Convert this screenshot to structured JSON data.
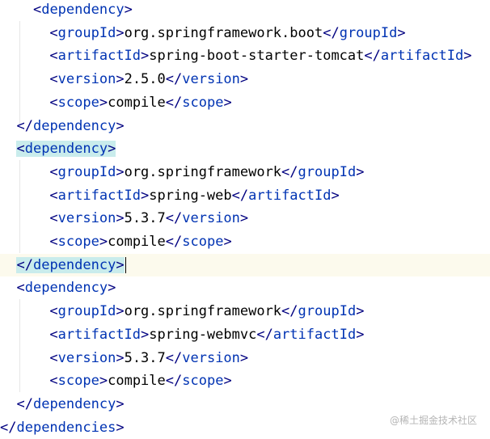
{
  "editor": {
    "lines": [
      {
        "open": "<",
        "name": "dependency",
        "close": ">"
      },
      {
        "open": "<",
        "name": "groupId",
        "close": ">",
        "value": "org.springframework.boot",
        "end_open": "</",
        "end_name": "groupId",
        "end_close": ">"
      },
      {
        "open": "<",
        "name": "artifactId",
        "close": ">",
        "value": "spring-boot-starter-tomcat",
        "end_open": "</",
        "end_name": "artifactId",
        "end_close": ">"
      },
      {
        "open": "<",
        "name": "version",
        "close": ">",
        "value": "2.5.0",
        "end_open": "</",
        "end_name": "version",
        "end_close": ">"
      },
      {
        "open": "<",
        "name": "scope",
        "close": ">",
        "value": "compile",
        "end_open": "</",
        "end_name": "scope",
        "end_close": ">"
      },
      {
        "open": "</",
        "name": "dependency",
        "close": ">"
      },
      {
        "open": "<",
        "name": "dependency",
        "close": ">"
      },
      {
        "open": "<",
        "name": "groupId",
        "close": ">",
        "value": "org.springframework",
        "end_open": "</",
        "end_name": "groupId",
        "end_close": ">"
      },
      {
        "open": "<",
        "name": "artifactId",
        "close": ">",
        "value": "spring-web",
        "end_open": "</",
        "end_name": "artifactId",
        "end_close": ">"
      },
      {
        "open": "<",
        "name": "version",
        "close": ">",
        "value": "5.3.7",
        "end_open": "</",
        "end_name": "version",
        "end_close": ">"
      },
      {
        "open": "<",
        "name": "scope",
        "close": ">",
        "value": "compile",
        "end_open": "</",
        "end_name": "scope",
        "end_close": ">"
      },
      {
        "open": "</",
        "name": "dependency",
        "close": ">"
      },
      {
        "open": "<",
        "name": "dependency",
        "close": ">"
      },
      {
        "open": "<",
        "name": "groupId",
        "close": ">",
        "value": "org.springframework",
        "end_open": "</",
        "end_name": "groupId",
        "end_close": ">"
      },
      {
        "open": "<",
        "name": "artifactId",
        "close": ">",
        "value": "spring-webmvc",
        "end_open": "</",
        "end_name": "artifactId",
        "end_close": ">"
      },
      {
        "open": "<",
        "name": "version",
        "close": ">",
        "value": "5.3.7",
        "end_open": "</",
        "end_name": "version",
        "end_close": ">"
      },
      {
        "open": "<",
        "name": "scope",
        "close": ">",
        "value": "compile",
        "end_open": "</",
        "end_name": "scope",
        "end_close": ">"
      },
      {
        "open": "</",
        "name": "dependency",
        "close": ">"
      },
      {
        "open": "</",
        "name": "dependencies",
        "close": ">"
      }
    ]
  },
  "watermark": "@稀土掘金技术社区",
  "colors": {
    "tag_name": "#0033b3",
    "bracket": "#000080",
    "text": "#000000",
    "matched_tag_highlight": "#c9ecec",
    "current_line": "#fcfaed"
  }
}
